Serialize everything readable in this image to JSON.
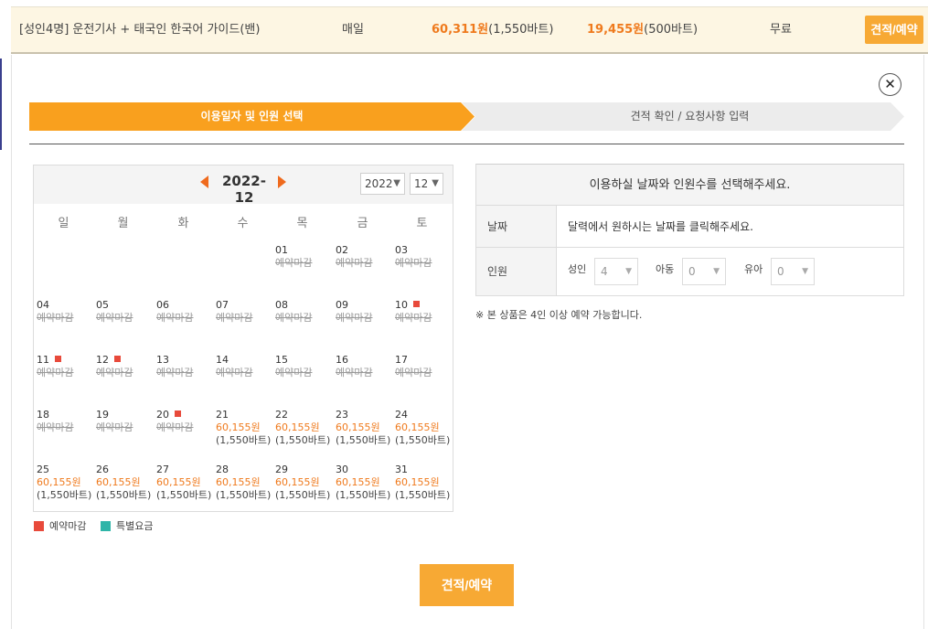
{
  "product": {
    "name": "[성인4명] 운전기사 + 태국인 한국어 가이드(밴)",
    "frequency": "매일",
    "adult_price": "60,311원",
    "adult_baht": "(1,550바트)",
    "child_price": "19,455원",
    "child_baht": "(500바트)",
    "fee": "무료",
    "book_label": "견적/예약"
  },
  "modal": {
    "close_symbol": "✕",
    "steps": [
      {
        "label": "이용일자 및 인원 선택",
        "active": true
      },
      {
        "label": "견적 확인 / 요청사항 입력",
        "active": false
      }
    ]
  },
  "calendar": {
    "title": "2022-12",
    "year_value": "2022",
    "month_value": "12",
    "weekdays": [
      "일",
      "월",
      "화",
      "수",
      "목",
      "금",
      "토"
    ],
    "closed_text": "예약마감",
    "days": [
      {
        "num": "01",
        "status": "closed",
        "marked": false
      },
      {
        "num": "02",
        "status": "closed",
        "marked": false
      },
      {
        "num": "03",
        "status": "closed",
        "marked": false
      },
      {
        "num": "04",
        "status": "closed",
        "marked": false
      },
      {
        "num": "05",
        "status": "closed",
        "marked": false
      },
      {
        "num": "06",
        "status": "closed",
        "marked": false
      },
      {
        "num": "07",
        "status": "closed",
        "marked": false
      },
      {
        "num": "08",
        "status": "closed",
        "marked": false
      },
      {
        "num": "09",
        "status": "closed",
        "marked": false
      },
      {
        "num": "10",
        "status": "closed",
        "marked": true
      },
      {
        "num": "11",
        "status": "closed",
        "marked": true
      },
      {
        "num": "12",
        "status": "closed",
        "marked": true
      },
      {
        "num": "13",
        "status": "closed",
        "marked": false
      },
      {
        "num": "14",
        "status": "closed",
        "marked": false
      },
      {
        "num": "15",
        "status": "closed",
        "marked": false
      },
      {
        "num": "16",
        "status": "closed",
        "marked": false
      },
      {
        "num": "17",
        "status": "closed",
        "marked": false
      },
      {
        "num": "18",
        "status": "closed",
        "marked": false
      },
      {
        "num": "19",
        "status": "closed",
        "marked": false
      },
      {
        "num": "20",
        "status": "closed",
        "marked": true
      },
      {
        "num": "21",
        "status": "open",
        "price": "60,155원",
        "baht": "(1,550바트)"
      },
      {
        "num": "22",
        "status": "open",
        "price": "60,155원",
        "baht": "(1,550바트)"
      },
      {
        "num": "23",
        "status": "open",
        "price": "60,155원",
        "baht": "(1,550바트)"
      },
      {
        "num": "24",
        "status": "open",
        "price": "60,155원",
        "baht": "(1,550바트)"
      },
      {
        "num": "25",
        "status": "open",
        "price": "60,155원",
        "baht": "(1,550바트)"
      },
      {
        "num": "26",
        "status": "open",
        "price": "60,155원",
        "baht": "(1,550바트)"
      },
      {
        "num": "27",
        "status": "open",
        "price": "60,155원",
        "baht": "(1,550바트)"
      },
      {
        "num": "28",
        "status": "open",
        "price": "60,155원",
        "baht": "(1,550바트)"
      },
      {
        "num": "29",
        "status": "open",
        "price": "60,155원",
        "baht": "(1,550바트)"
      },
      {
        "num": "30",
        "status": "open",
        "price": "60,155원",
        "baht": "(1,550바트)"
      },
      {
        "num": "31",
        "status": "open",
        "price": "60,155원",
        "baht": "(1,550바트)"
      }
    ],
    "first_weekday_index": 4
  },
  "legend": {
    "closed_label": "예약마감",
    "closed_color": "#e84a3b",
    "special_label": "특별요금",
    "special_color": "#2fb5a8"
  },
  "info": {
    "header": "이용하실 날짜와 인원수를 선택해주세요.",
    "date_label": "날짜",
    "date_text": "달력에서 원하시는 날짜를 클릭해주세요.",
    "people_label": "인원",
    "adult_label": "성인",
    "adult_value": "4",
    "child_label": "아동",
    "child_value": "0",
    "infant_label": "유아",
    "infant_value": "0"
  },
  "note": "※ 본 상품은 4인 이상 예약 가능합니다.",
  "main_button_label": "견적/예약",
  "accent_color": "#f9a01e"
}
